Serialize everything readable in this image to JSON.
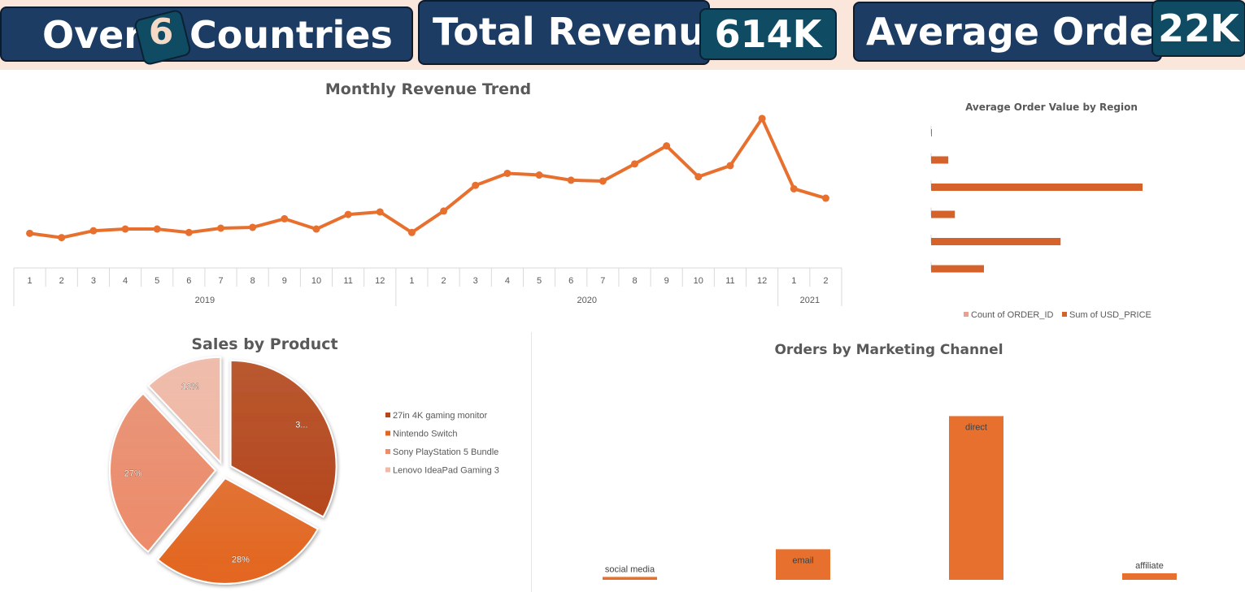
{
  "kpis": {
    "countries": {
      "prefix": "Over",
      "value": "6",
      "suffix": "Countries"
    },
    "revenue": {
      "label": "Total Revenue",
      "value": "614K"
    },
    "orders": {
      "label": "Average Orders",
      "value": "22K"
    }
  },
  "colors": {
    "accent": "#e8702e",
    "banner": "#fbe6dc",
    "kpi_box": "#1c3c64",
    "kpi_value_box": "#0f4b63",
    "light_series": "#e8a090"
  },
  "chart_data": [
    {
      "type": "line",
      "title": "Monthly Revenue Trend",
      "x": [
        "1",
        "2",
        "3",
        "4",
        "5",
        "6",
        "7",
        "8",
        "9",
        "10",
        "11",
        "12",
        "1",
        "2",
        "3",
        "4",
        "5",
        "6",
        "7",
        "8",
        "9",
        "10",
        "11",
        "12",
        "1",
        "2"
      ],
      "groups": [
        {
          "label": "2019",
          "count": 12
        },
        {
          "label": "2020",
          "count": 12
        },
        {
          "label": "2021",
          "count": 2
        }
      ],
      "values": [
        15.0,
        12.5,
        16.5,
        17.5,
        17.5,
        15.5,
        18.0,
        18.5,
        23.5,
        17.5,
        26.0,
        27.5,
        15.5,
        28.0,
        43.0,
        50.0,
        49.0,
        46.0,
        45.5,
        55.5,
        66.0,
        48.0,
        54.5,
        82.0,
        41.0,
        35.5
      ],
      "ylim": [
        0,
        90
      ],
      "grid": false,
      "color": "#e8702e"
    },
    {
      "type": "bar",
      "orientation": "horizontal",
      "title": "Average Order Value by Region",
      "categories": [
        "",
        "",
        "",
        "",
        "",
        ""
      ],
      "series": [
        {
          "name": "Count of ORDER_ID",
          "values": [
            0,
            0,
            0,
            0,
            0,
            0
          ],
          "color": "#e8a090"
        },
        {
          "name": "Sum of USD_PRICE",
          "values": [
            0.2,
            6.5,
            80,
            9,
            49,
            20
          ],
          "color": "#d4622a"
        }
      ],
      "xlim": [
        0,
        100
      ],
      "legend": "bottom"
    },
    {
      "type": "pie",
      "title": "Sales by Product",
      "labels": [
        "27in 4K gaming monitor",
        "Nintendo Switch",
        "Sony PlayStation 5 Bundle",
        "Lenovo IdeaPad Gaming 3"
      ],
      "values": [
        33,
        28,
        27,
        12
      ],
      "data_labels": [
        "3...",
        "28%",
        "27%",
        "12%"
      ],
      "colors": [
        "#b5471b",
        "#e3651f",
        "#ec8c6b",
        "#f2b9a6"
      ],
      "legend": "right"
    },
    {
      "type": "bar",
      "title": "Orders by Marketing Channel",
      "categories": [
        "social media",
        "email",
        "direct",
        "affiliate"
      ],
      "values": [
        0.4,
        4.2,
        22.5,
        0.9
      ],
      "ylim": [
        0,
        25
      ],
      "color": "#e8702e"
    }
  ]
}
